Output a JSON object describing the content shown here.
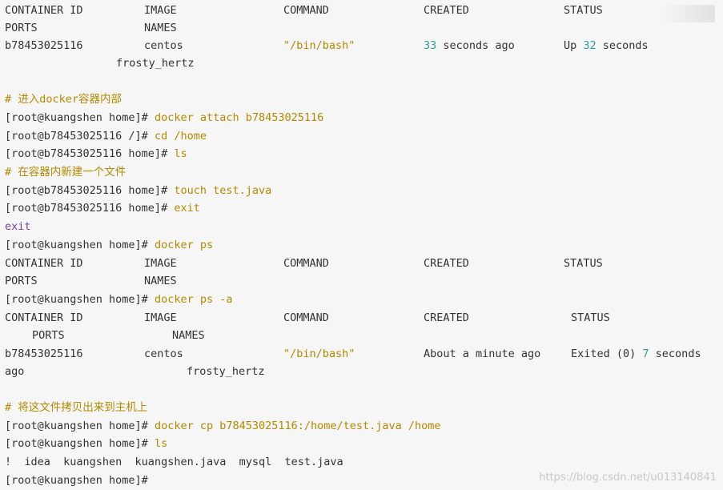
{
  "header1": {
    "container_id": "CONTAINER ID",
    "image": "IMAGE",
    "command": "COMMAND",
    "created": "CREATED",
    "status": "STATUS",
    "ports": "PORTS",
    "names": "NAMES"
  },
  "row1": {
    "id": "b78453025116",
    "image": "centos",
    "command": "\"/bin/bash\"",
    "created_num": "33",
    "created_rest": " seconds ago",
    "status_pre": "Up ",
    "status_num": "32",
    "status_rest": " seconds",
    "name": "frosty_hertz"
  },
  "lines": {
    "comment1": "# 进入docker容器内部",
    "p1": "[root@kuangshen home]# ",
    "c1": "docker attach b78453025116",
    "p2": "[root@b78453025116 /]# ",
    "c2": "cd /home",
    "p3": "[root@b78453025116 home]# ",
    "c3": "ls",
    "comment2": "# 在容器内新建一个文件",
    "p4": "[root@b78453025116 home]# ",
    "c4": "touch test.java",
    "p5": "[root@b78453025116 home]# ",
    "c5": "exit",
    "exit_out": "exit",
    "p6": "[root@kuangshen home]# ",
    "c6": "docker ps",
    "p7": "[root@kuangshen home]# ",
    "c7": "docker ps -a",
    "comment3": "# 将这文件拷贝出来到主机上",
    "p8": "[root@kuangshen home]# ",
    "c8": "docker cp b78453025116:/home/test.java /home",
    "p9": "[root@kuangshen home]# ",
    "c9": "ls",
    "ls_out": "!  idea  kuangshen  kuangshen.java  mysql  test.java",
    "p10": "[root@kuangshen home]# "
  },
  "row2": {
    "id": "b78453025116",
    "image": "centos",
    "command": "\"/bin/bash\"",
    "created": "About a minute ago",
    "status_pre": "Exited (0) ",
    "status_num": "7",
    "status_rest": " seconds",
    "ago": "ago",
    "name": "frosty_hertz"
  },
  "watermark": "https://blog.csdn.net/u013140841"
}
